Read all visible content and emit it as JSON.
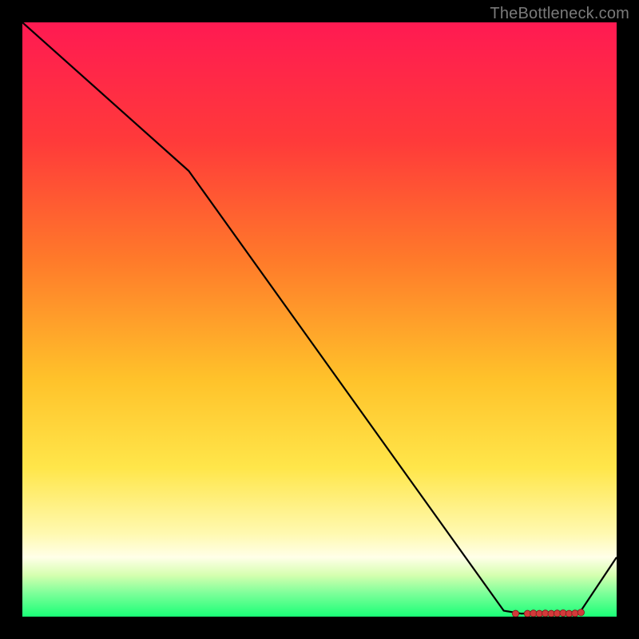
{
  "attribution": "TheBottleneck.com",
  "chart_data": {
    "type": "line",
    "title": "",
    "xlabel": "",
    "ylabel": "",
    "xlim": [
      0,
      100
    ],
    "ylim": [
      0,
      100
    ],
    "grid": false,
    "legend": false,
    "background": "rainbow-gradient",
    "series": [
      {
        "name": "curve",
        "x": [
          0,
          28,
          81,
          84,
          86,
          88,
          90,
          92,
          94,
          100
        ],
        "values": [
          100,
          75,
          1,
          0.5,
          0.6,
          0.55,
          0.6,
          0.5,
          1,
          10
        ]
      }
    ],
    "markers": {
      "name": "highlight-points",
      "color": "#d23a3a",
      "x": [
        83,
        85,
        86,
        87,
        88,
        89,
        90,
        91,
        92,
        93,
        94
      ],
      "values": [
        0.5,
        0.5,
        0.55,
        0.5,
        0.55,
        0.5,
        0.55,
        0.6,
        0.5,
        0.55,
        0.7
      ]
    },
    "gradient_stops": [
      {
        "offset": 0.0,
        "color": "#ff1a52"
      },
      {
        "offset": 0.2,
        "color": "#ff3a3a"
      },
      {
        "offset": 0.4,
        "color": "#ff7a2a"
      },
      {
        "offset": 0.6,
        "color": "#ffc22a"
      },
      {
        "offset": 0.75,
        "color": "#ffe64a"
      },
      {
        "offset": 0.86,
        "color": "#fff9b0"
      },
      {
        "offset": 0.9,
        "color": "#ffffe8"
      },
      {
        "offset": 0.93,
        "color": "#d6ffb0"
      },
      {
        "offset": 0.96,
        "color": "#7fff9a"
      },
      {
        "offset": 1.0,
        "color": "#1aff77"
      }
    ]
  }
}
